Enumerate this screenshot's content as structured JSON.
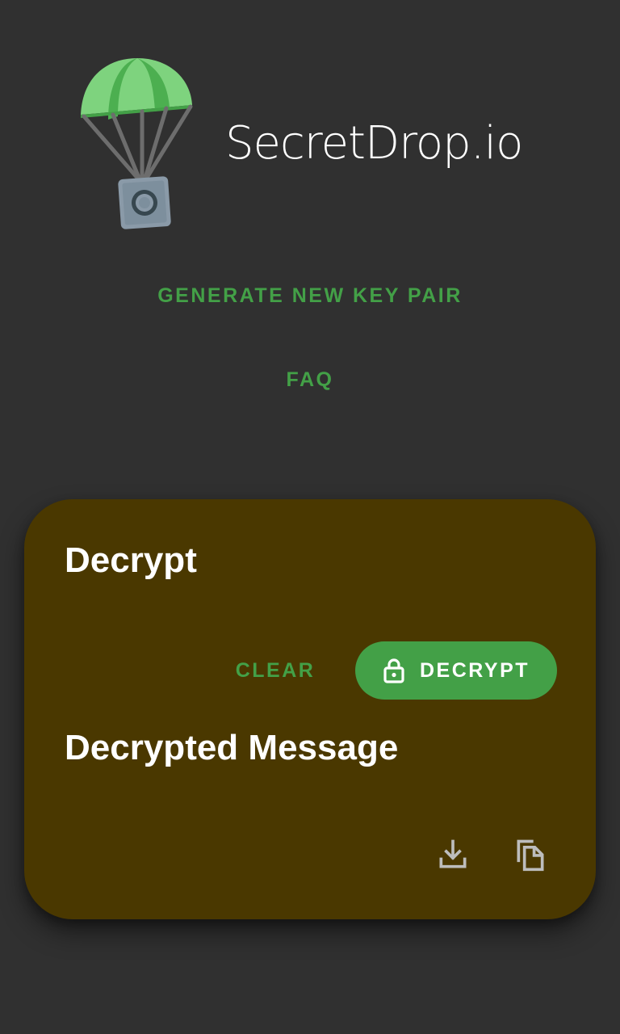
{
  "header": {
    "logo_icon": "parachute-safe-logo",
    "site_title": "SecretDrop.io"
  },
  "nav": {
    "generate_label": "GENERATE NEW KEY PAIR",
    "faq_label": "FAQ"
  },
  "card": {
    "title": "Decrypt",
    "clear_label": "CLEAR",
    "decrypt_label": "DECRYPT",
    "decrypt_icon": "lock-icon",
    "output_title": "Decrypted Message",
    "download_icon": "download-icon",
    "copy_icon": "copy-icon"
  },
  "colors": {
    "background": "#303030",
    "accent_green": "#43a047",
    "card_background": "#4a3800",
    "icon_gray": "#bdbdbd"
  }
}
